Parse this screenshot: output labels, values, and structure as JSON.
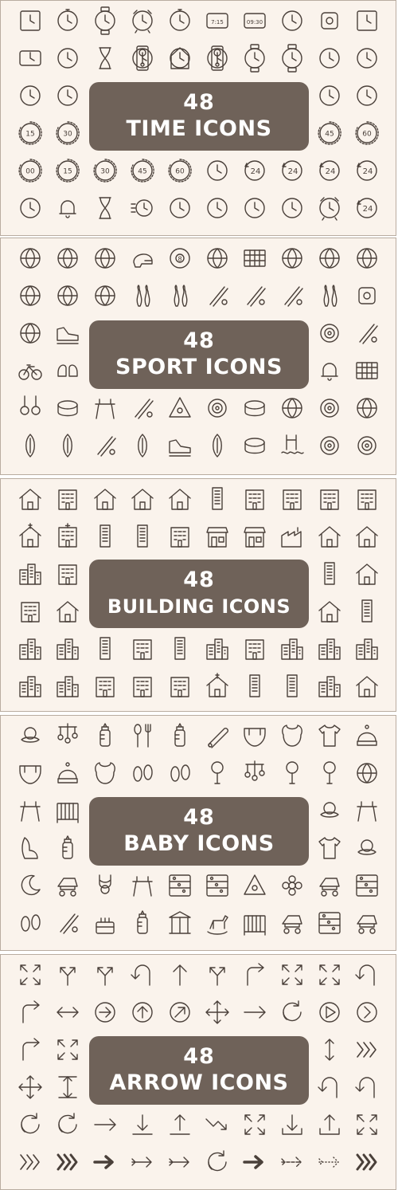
{
  "colors": {
    "background": "#faf3ec",
    "stroke": "#4a403a",
    "banner": "#6f6259",
    "banner_text": "#ffffff",
    "border": "#b9aca0"
  },
  "sections": [
    {
      "id": "time",
      "count": "48",
      "title": "TIME ICONS",
      "icons": [
        "square-clock-icon",
        "stopwatch-icon",
        "wristwatch-icon",
        "alarm-clock-icon",
        "pocket-watch-icon",
        "digital-calendar-clock-icon",
        "digital-clock-icon",
        "wall-clock-icon",
        "digital-display-icon",
        "square-clock-icon",
        "tv-clock-icon",
        "dotted-clock-icon",
        "egg-timer-icon",
        "grandfather-clock-icon",
        "cuckoo-clock-icon",
        "pendulum-clock-icon",
        "smartwatch-icon",
        "wristwatch-icon",
        "mantel-clock-icon",
        "round-clock-icon",
        "dashed-clock-icon",
        "clock-icon",
        "clock-reverse-icon",
        "gear-clock-icon",
        "timer-15-icon",
        "timer-30-icon",
        "timer-45-icon",
        "timer-60-icon",
        "timer-00-icon",
        "timer-15-icon",
        "timer-30-icon",
        "timer-45-icon",
        "timer-60-icon",
        "shield-clock-icon",
        "clock-24-icon",
        "clock-24-icon",
        "clock-24-icon",
        "globe-24-icon",
        "clock-bell-icon",
        "ringing-bell-icon",
        "hourglass-icon",
        "fast-timer-icon",
        "flaming-clock-icon",
        "hand-clock-icon",
        "click-clock-icon",
        "hands-clock-icon",
        "alarm-icon",
        "clock-24-icon"
      ]
    },
    {
      "id": "sport",
      "count": "48",
      "title": "SPORT ICONS",
      "icons": [
        "basketball-icon",
        "basketball-hoop-icon",
        "football-icon",
        "helmet-icon",
        "billiard-ball-icon",
        "soccer-ball-icon",
        "soccer-goal-icon",
        "volleyball-icon",
        "volleyball-net-icon",
        "tennis-ball-icon",
        "baseball-icon",
        "baseball-field-icon",
        "bowling-ball-icon",
        "bowling-pins-icon",
        "shuttlecock-icon",
        "baseball-bat-icon",
        "hockey-sticks-icon",
        "badminton-racket-icon",
        "bowling-strike-icon",
        "ping-pong-icon",
        "basketball-net-icon",
        "sneaker-icon",
        "golf-course-icon",
        "hockey-stick-icon",
        "bicycle-icon",
        "boxing-gloves-icon",
        "dumbbell-icon",
        "soccer-field-icon",
        "gymnastic-rings-icon",
        "tape-icon",
        "pommel-horse-icon",
        "tennis-racket-icon",
        "pool-rack-icon",
        "golf-hole-icon",
        "punching-bag-icon",
        "golf-ball-tee-icon",
        "target-icon",
        "basketball-court-icon",
        "flippers-icon",
        "kayak-icon",
        "ski-poles-icon",
        "surfboard-icon",
        "ice-skate-icon",
        "snowboard-icon",
        "curling-stone-icon",
        "swimming-pool-icon",
        "archery-icon",
        "fencing-icon"
      ]
    },
    {
      "id": "building",
      "count": "48",
      "title": "BUILDING ICONS",
      "icons": [
        "house-icon",
        "apartment-icon",
        "house-icon",
        "house-icon",
        "house-icon",
        "tower-icon",
        "office-building-icon",
        "office-building-icon",
        "school-icon",
        "office-building-icon",
        "church-icon",
        "hospital-icon",
        "skyscraper-icon",
        "tower-icon",
        "building-icon",
        "shop-icon",
        "store-icon",
        "factory-icon",
        "barn-icon",
        "warehouse-icon",
        "buildings-icon",
        "school-icon",
        "tall-building-icon",
        "house-icon",
        "apartment-icon",
        "house-icon",
        "house-icon",
        "tower-icon",
        "city-icon",
        "buildings-icon",
        "tower-icon",
        "building-icon",
        "tower-icon",
        "buildings-icon",
        "office-building-icon",
        "city-icon",
        "city-icon",
        "city-icon",
        "city-icon",
        "city-icon",
        "apartment-icon",
        "building-icon",
        "school-icon",
        "church-icon",
        "tower-icon",
        "skyscraper-icon",
        "city-icon",
        "row-houses-icon"
      ]
    },
    {
      "id": "baby",
      "count": "48",
      "title": "BABY ICONS",
      "icons": [
        "pacifier-icon",
        "baby-mobile-icon",
        "baby-bottle-icon",
        "spoon-fork-icon",
        "sippy-cup-icon",
        "safety-pin-icon",
        "diaper-icon",
        "bib-icon",
        "onesie-icon",
        "baby-hat-icon",
        "diaper-icon",
        "knit-hat-icon",
        "bib-icon",
        "baby-shoes-icon",
        "socks-icon",
        "rattle-icon",
        "mobile-icon",
        "rattle-icon",
        "rattle-icon",
        "ball-icon",
        "high-chair-icon",
        "crib-icon",
        "teether-icon",
        "high-chair-icon",
        "car-seat-icon",
        "formula-icon",
        "dress-icon",
        "pacifier-icon",
        "night-moon-icon",
        "stroller-icon",
        "baby-carrier-icon",
        "swing-icon",
        "toys-icon",
        "abacus-icon",
        "stacking-rings-icon",
        "flower-icon",
        "toy-train-icon",
        "abc-blocks-icon",
        "footprints-icon",
        "bathtub-icon",
        "birthday-cake-icon",
        "baby-food-icon",
        "carousel-icon",
        "rocking-horse-icon",
        "playpen-icon",
        "baby-walker-icon",
        "shape-sorter-icon",
        "toy-car-icon"
      ]
    },
    {
      "id": "arrow",
      "count": "48",
      "title": "ARROW ICONS",
      "icons": [
        "expand-arrows-icon",
        "split-arrows-icon",
        "merge-arrows-icon",
        "u-turn-arrow-icon",
        "up-arrow-icon",
        "fork-arrow-icon",
        "curve-arrow-icon",
        "corner-arrows-icon",
        "cross-arrows-icon",
        "undo-arrow-icon",
        "signpost-arrows-icon",
        "double-arrow-icon",
        "circle-right-arrow-icon",
        "circle-up-arrow-icon",
        "circle-diagonal-arrow-icon",
        "move-arrows-icon",
        "right-arrow-icon",
        "refresh-arrows-icon",
        "play-circle-icon",
        "chevron-circle-icon",
        "turn-arrow-icon",
        "collapse-arrows-icon",
        "up-down-arrows-icon",
        "double-chevron-icon",
        "move-arrows-icon",
        "vertical-resize-icon",
        "s-curve-arrow-icon",
        "return-arrow-icon",
        "rotate-arrow-icon",
        "sync-arrows-icon",
        "long-right-arrow-icon",
        "download-arrow-icon",
        "upload-arrow-icon",
        "zigzag-arrow-icon",
        "shrink-arrow-icon",
        "download-tray-icon",
        "upload-tray-icon",
        "expand-arrow-icon",
        "triple-chevron-icon",
        "double-chevron-bold-icon",
        "bold-right-arrow-icon",
        "feather-arrow-icon",
        "feathered-arrow-icon",
        "recycle-icon",
        "bold-turn-arrow-icon",
        "dashed-arrow-icon",
        "dotted-arrow-icon",
        "bold-chevron-icon"
      ]
    }
  ]
}
